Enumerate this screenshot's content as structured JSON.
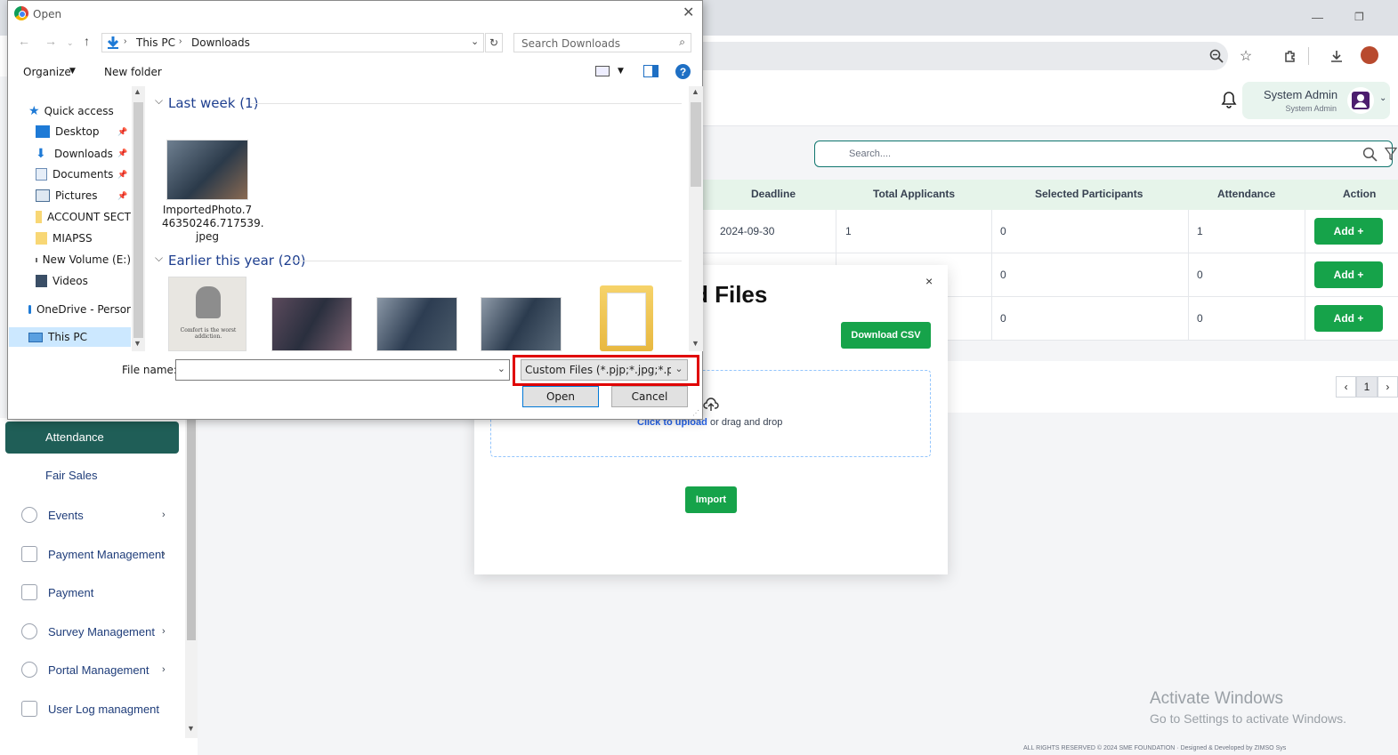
{
  "browser": {
    "min_label": "—",
    "restore_label": "❐"
  },
  "app": {
    "user_name": "System Admin",
    "user_role": "System Admin",
    "search_placeholder": "Search....",
    "table": {
      "headers": [
        "Deadline",
        "Total Applicants",
        "Selected Participants",
        "Attendance",
        "Action"
      ],
      "rows": [
        {
          "deadline": "2024-09-30",
          "total": "1",
          "selected": "0",
          "attendance": "1",
          "action": "Add +"
        },
        {
          "deadline": "",
          "total": "",
          "selected": "0",
          "attendance": "0",
          "action": "Add +"
        },
        {
          "deadline": "",
          "total": "",
          "selected": "0",
          "attendance": "0",
          "action": "Add +"
        }
      ]
    },
    "pager": {
      "prev": "‹",
      "current": "1",
      "next": "›"
    },
    "sidebar": {
      "active": "Attendance",
      "items": [
        "Fair Sales",
        "Events",
        "Payment Management",
        "Payment",
        "Survey Management",
        "Portal Management",
        "User Log managment"
      ]
    },
    "modal": {
      "title": "d Files",
      "download_csv": "Download CSV",
      "click_upload": "Click to upload",
      "drag_drop": "or drag and drop",
      "import": "Import",
      "close": "×"
    },
    "activate_title": "Activate Windows",
    "activate_sub": "Go to Settings to activate Windows.",
    "footer": "ALL RIGHTS RESERVED © 2024 SME FOUNDATION · Designed & Developed by ZIMSO Sys"
  },
  "dialog": {
    "title": "Open",
    "breadcrumb": [
      "This PC",
      "Downloads"
    ],
    "search_placeholder": "Search Downloads",
    "organize": "Organize",
    "new_folder": "New folder",
    "nav_items": [
      "Quick access",
      "Desktop",
      "Downloads",
      "Documents",
      "Pictures",
      "ACCOUNT SECT",
      "MIAPSS",
      "New Volume (E:)",
      "Videos",
      "OneDrive - Persor",
      "This PC"
    ],
    "groups": {
      "last_week": "Last week (1)",
      "earlier": "Earlier this year (20)"
    },
    "file1_name": "ImportedPhoto.746350246.717539.jpeg",
    "file1_lines": [
      "ImportedPhoto.7",
      "46350246.717539.",
      "jpeg"
    ],
    "quote_text": "Comfort is the worst addiction.",
    "file_name_label": "File name:",
    "file_name_value": "",
    "file_type": "Custom Files (*.pjp;*.jpg;*.pjpeg",
    "open": "Open",
    "cancel": "Cancel"
  }
}
